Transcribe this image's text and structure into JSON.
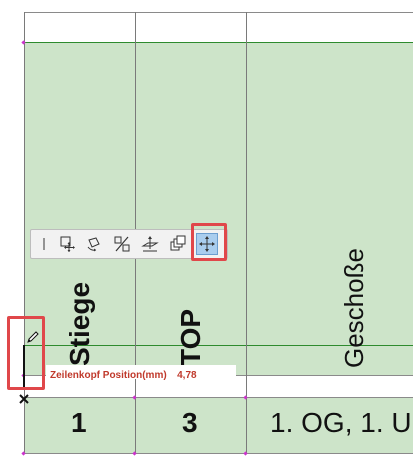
{
  "table": {
    "headers": {
      "stiege": "Stiege",
      "top": "TOP",
      "geschoss": "Geschoße"
    },
    "row": {
      "stiege": "1",
      "top": "3",
      "geschoss": "1. OG, 1. U"
    }
  },
  "toolbar": {
    "items": [
      {
        "icon": "separator-icon"
      },
      {
        "icon": "move-node-icon"
      },
      {
        "icon": "rotate-icon"
      },
      {
        "icon": "mirror-icon"
      },
      {
        "icon": "elevate-icon"
      },
      {
        "icon": "multiply-icon"
      },
      {
        "icon": "offset-icon",
        "active": true
      }
    ]
  },
  "tooltip": {
    "label": "Zeilenkopf Position(mm)",
    "value": "4,78"
  },
  "colors": {
    "cell_fill": "#cde4c9",
    "grid_green": "#2e8b2e",
    "highlight": "#e0474a",
    "tooltip_text": "#c0392b",
    "active_button": "#a9cdee"
  }
}
